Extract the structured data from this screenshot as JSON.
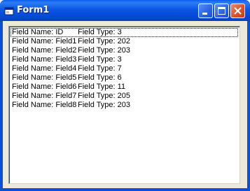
{
  "window": {
    "title": "Form1",
    "icon": "vb-form-icon",
    "controls": {
      "minimize": "minimize-icon",
      "maximize": "maximize-icon",
      "close": "close-icon"
    },
    "colors": {
      "titlebar": "#0a4fd8",
      "client": "#ece9d8",
      "close_button": "#d9532c"
    }
  },
  "listbox": {
    "selected_index": 0,
    "items": [
      {
        "name": "Field Name: ID",
        "type": "Field Type: 3"
      },
      {
        "name": "Field Name: Field1",
        "type": "Field Type: 202"
      },
      {
        "name": "Field Name: Field2",
        "type": "Field Type: 203"
      },
      {
        "name": "Field Name: Field3",
        "type": "Field Type: 3"
      },
      {
        "name": "Field Name: Field4",
        "type": "Field Type: 7"
      },
      {
        "name": "Field Name: Field5",
        "type": "Field Type: 6"
      },
      {
        "name": "Field Name: Field6",
        "type": "Field Type: 11"
      },
      {
        "name": "Field Name: Field7",
        "type": "Field Type: 205"
      },
      {
        "name": "Field Name: Field8",
        "type": "Field Type: 203"
      }
    ]
  }
}
